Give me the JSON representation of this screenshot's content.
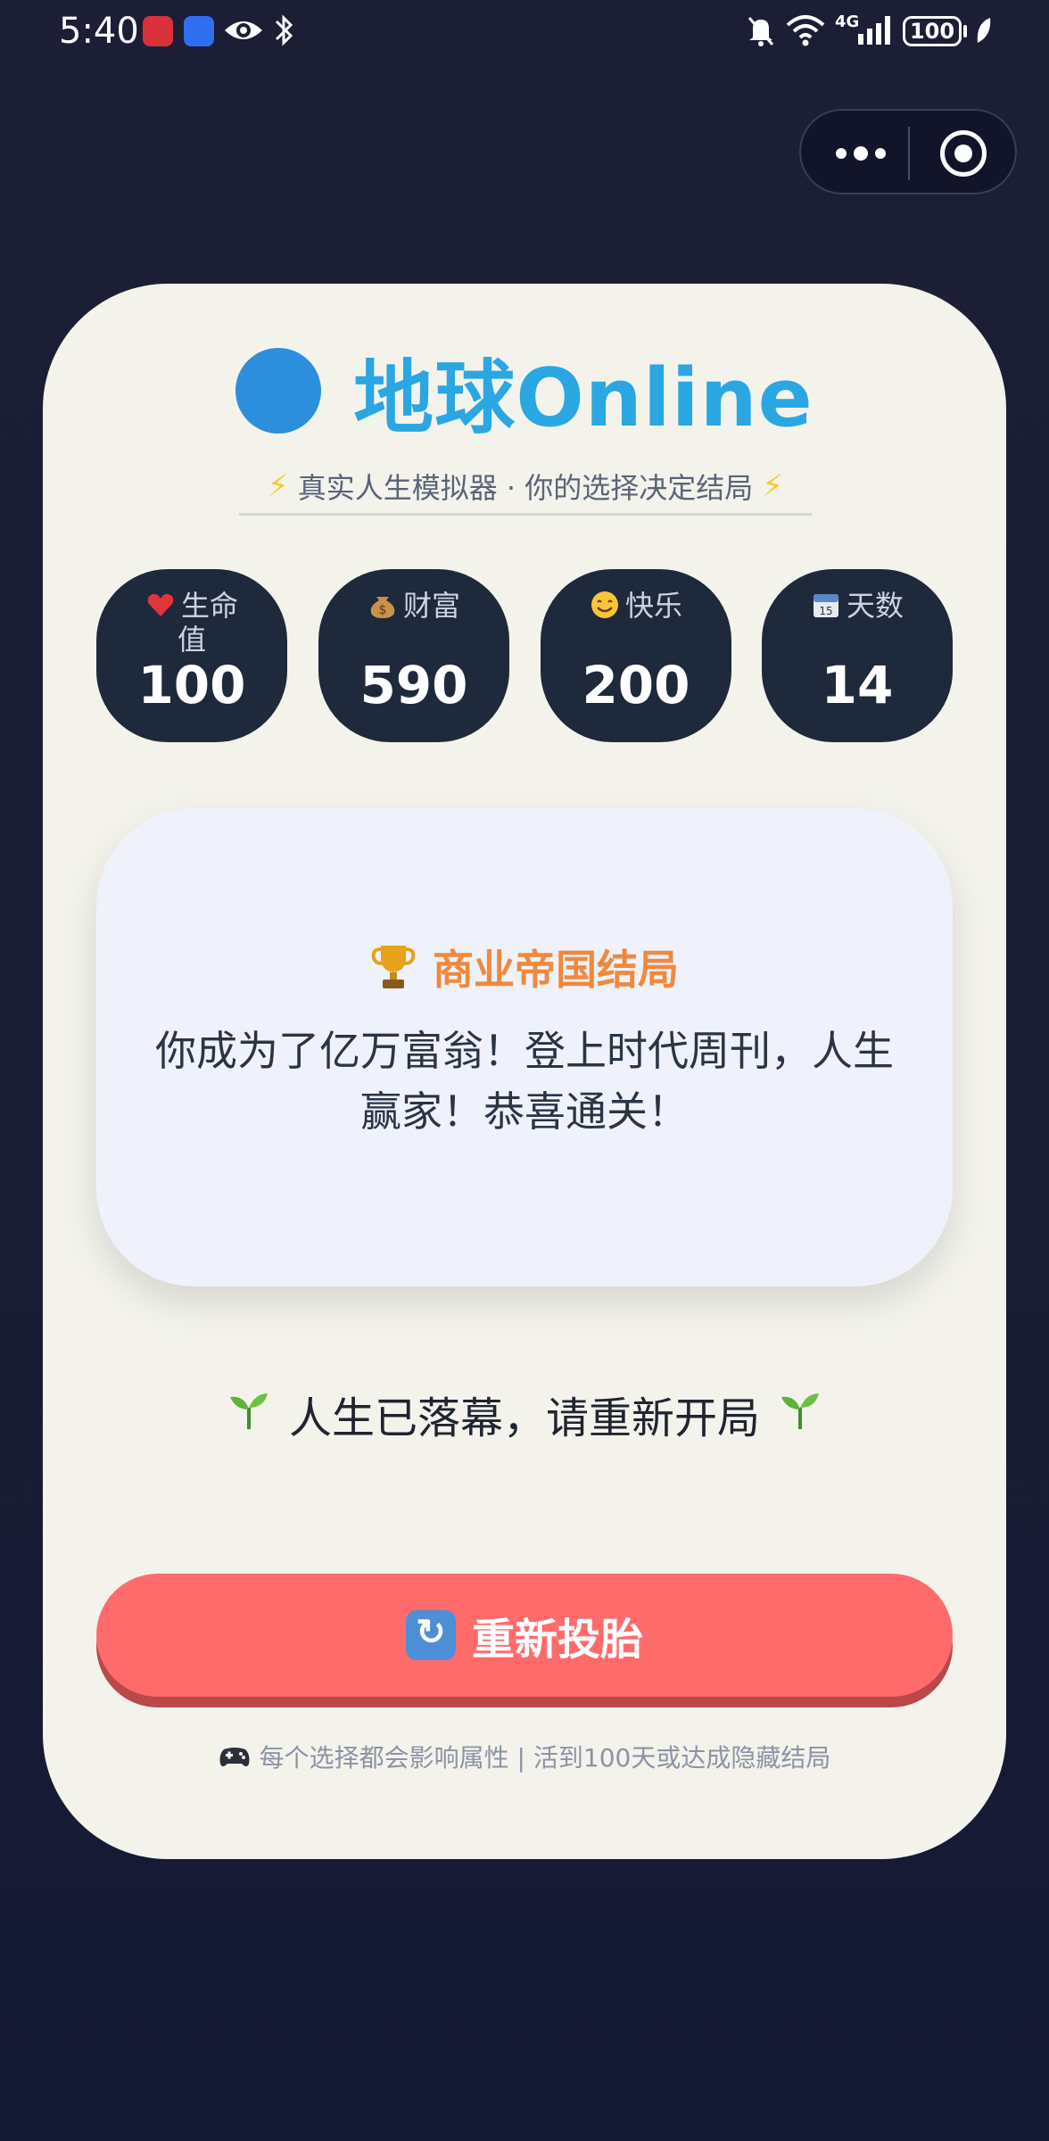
{
  "status_bar": {
    "time": "5:40",
    "icons": [
      "huawei-app-icon",
      "blue-app-icon",
      "eye-icon",
      "bluetooth-icon",
      "mute-icon",
      "wifi-icon",
      "signal-icon"
    ],
    "network": "4G",
    "battery": "100"
  },
  "capsule": {
    "more_icon": "more-dots-icon",
    "close_icon": "target-close-icon"
  },
  "header": {
    "globe_icon": "globe-icon",
    "title": "地球Online",
    "subtitle": "真实人生模拟器 · 你的选择决定结局",
    "bolt_icon": "lightning-icon"
  },
  "stats": [
    {
      "icon": "heart-icon",
      "label": "生命值",
      "value": "100"
    },
    {
      "icon": "money-bag-icon",
      "label": "财富",
      "value": "590"
    },
    {
      "icon": "smile-icon",
      "label": "快乐",
      "value": "200"
    },
    {
      "icon": "calendar-icon",
      "label": "天数",
      "value": "14"
    }
  ],
  "ending": {
    "icon": "trophy-icon",
    "title": "商业帝国结局",
    "description": "你成为了亿万富翁！登上时代周刊，人生赢家！恭喜通关！"
  },
  "status_message": "人生已落幕，请重新开局",
  "restart_button": {
    "icon": "refresh-icon",
    "label": "重新投胎"
  },
  "footer": "每个选择都会影响属性 | 活到100天或达成隐藏结局",
  "colors": {
    "background": "#1b1e35",
    "card": "#f3f3ec",
    "title": "#2aa7e3",
    "stat_bg": "#1e293b",
    "ending_title": "#f0893d",
    "button": "#ff6b6b"
  }
}
